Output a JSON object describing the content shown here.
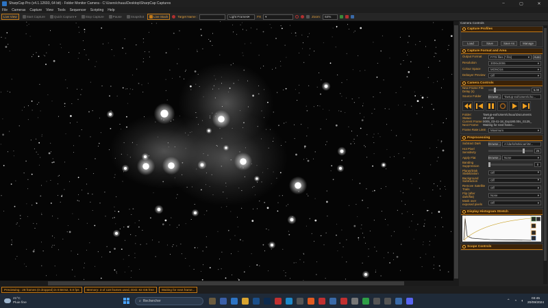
{
  "window": {
    "title": "SharpCap Pro (v4.1.12693, 64 bit) - Folder Monitor Camera - C:\\Users\\chuuu\\Desktop\\SharpCap Captures"
  },
  "menu": [
    "File",
    "Cameras",
    "Capture",
    "View",
    "Tools",
    "Sequencer",
    "Scripting",
    "Help"
  ],
  "toolbar": {
    "live_view": "Live View",
    "start_capture": "Start Capture",
    "quick_capture": "Quick Capture",
    "stop_capture": "Stop Capture",
    "pause": "Pause",
    "snapshot": "Snapshot",
    "live_stack": "Live Stack",
    "target_name_label": "Target Name :",
    "frame_type": "Light Frames",
    "fx_label": "FX",
    "zoom_label": "Zoom:",
    "zoom_value": "64%"
  },
  "panel": {
    "header": "Camera Controls",
    "capture_profiles": {
      "title": "Capture Profiles",
      "buttons": [
        "Load",
        "Save",
        "Save As",
        "Manage"
      ]
    },
    "capture_format": {
      "title": "Capture Format and Area",
      "output_format_label": "Output Format",
      "output_format_value": "FITS files (*.fits)",
      "auto_button": "Auto",
      "resolution_label": "Resolution",
      "resolution_value": "3006x3006",
      "colour_space_label": "Colour Space",
      "colour_space_value": "MONO16",
      "debayer_label": "Debayer Preview",
      "debayer_value": "Off"
    },
    "camera_controls": {
      "title": "Camera Controls",
      "new_frame_delay_label": "New Frame File Delay (s)",
      "new_frame_delay_value": "5.00",
      "source_folder_label": "Source Folder",
      "browse_button": "Browse...",
      "source_folder_value": "Taetup-exit\\Users\\cho...",
      "folder_label": "Folder:",
      "folder_value": "Taetup-exit\\Users\\chuuu\\Documents",
      "status_label": "Status:",
      "status_value": "28 of 28",
      "current_frame_label": "Current Frame:",
      "current_frame_value": "0005_03-41-18_Exp180.00s_G125_",
      "next_frame_label": "Next Frame:",
      "next_frame_value": "Waiting for next frame...",
      "frame_rate_label": "Frame Rate Limit",
      "frame_rate_value": "Maximum"
    },
    "preprocessing": {
      "title": "Preprocessing",
      "subtract_dark_label": "Subtract Dark",
      "subtract_dark_browse": "Browse...",
      "subtract_dark_value": "A:\\darks\\Minicam\\M...",
      "hot_pixel_label": "Hot Pixel Sensitivity",
      "hot_pixel_value": "25",
      "apply_flat_label": "Apply Flat",
      "apply_flat_browse": "Browse...",
      "apply_flat_value": "None",
      "banding_label": "Banding Suppression",
      "banding_value": "0",
      "planet_label": "Planet/Disk Stabilization",
      "planet_value": "Off",
      "background_label": "Background Subtraction",
      "background_value": "Off",
      "remove_sat_label": "Remove Satellite Trails",
      "remove_sat_value": "Off",
      "flip_label": "Flip (after dark/flat)",
      "flip_value": "None",
      "mask_label": "Mask over exposed pixels",
      "mask_value": "Off"
    },
    "histogram": {
      "title": "Display Histogram Stretch"
    },
    "scope_controls": {
      "title": "Scope Controls"
    }
  },
  "status": {
    "previewing": "Previewing : 28 frames (0 dropped) in 0:58:52, 0.0 fps",
    "memory": "Memory: 3 of 118 frames used, Disk: 82 GB free",
    "waiting": "Waiting for next frame..."
  },
  "taskbar": {
    "temperature": "21°C",
    "weather": "Pluie fine",
    "search_placeholder": "Rechercher",
    "time": "03:45",
    "date": "20/09/2024"
  },
  "colors": {
    "accent": "#e8a33d",
    "section_bg": "#3a2208",
    "taskbar": "#1f2a38"
  },
  "icons": [
    "windows-logo-icon",
    "search-icon",
    "play-icon",
    "pause-icon",
    "fast-rewind-icon",
    "skip-end-icon",
    "refresh-icon",
    "cloud-icon"
  ]
}
